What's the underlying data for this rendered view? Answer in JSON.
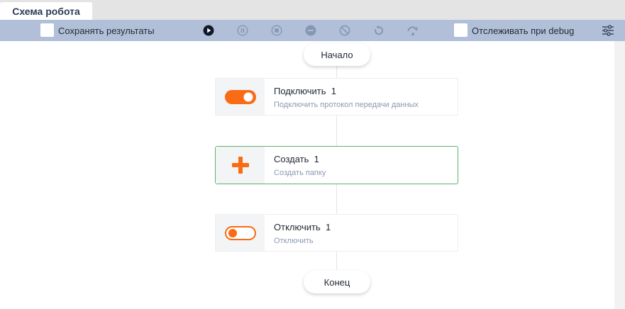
{
  "tabs": [
    {
      "label": "Схема робота"
    }
  ],
  "toolbar": {
    "save_results_label": "Сохранять результаты",
    "save_results_checked": false,
    "track_debug_label": "Отслеживать при debug",
    "track_debug_checked": false,
    "buttons": [
      {
        "icon": "play-icon",
        "enabled": true
      },
      {
        "icon": "pause-icon",
        "enabled": false
      },
      {
        "icon": "stop-icon",
        "enabled": false
      },
      {
        "icon": "minus-circle-icon",
        "enabled": false
      },
      {
        "icon": "forbidden-icon",
        "enabled": false
      },
      {
        "icon": "restart-icon",
        "enabled": false
      },
      {
        "icon": "step-over-icon",
        "enabled": false
      }
    ],
    "settings_icon": "sliders-icon"
  },
  "flow": {
    "start_label": "Начало",
    "end_label": "Конец",
    "nodes": [
      {
        "title": "Подключить",
        "index": "1",
        "subtitle": "Подключить протокол передачи данных",
        "icon": "toggle-on-icon",
        "selected": false
      },
      {
        "title": "Создать",
        "index": "1",
        "subtitle": "Создать папку",
        "icon": "plus-icon",
        "selected": true
      },
      {
        "title": "Отключить",
        "index": "1",
        "subtitle": "Отключить",
        "icon": "toggle-off-icon",
        "selected": false
      }
    ]
  },
  "colors": {
    "accent": "#fb6a14",
    "toolbar_bg": "#b1c0d8",
    "selected_border": "#5cb16f",
    "subtitle": "#8d98b2"
  }
}
